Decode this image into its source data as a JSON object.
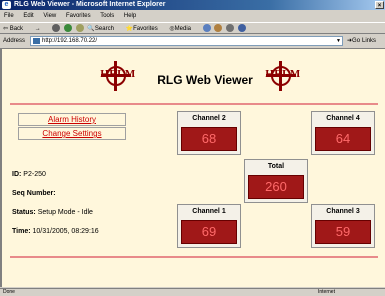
{
  "window": {
    "title": "RLG Web Viewer - Microsoft Internet Explorer"
  },
  "menu": [
    "File",
    "Edit",
    "View",
    "Favorites",
    "Tools",
    "Help"
  ],
  "toolbar": {
    "back": "Back",
    "forward": "→",
    "search": "Search",
    "favorites": "Favorites",
    "media": "Media"
  },
  "address": {
    "label": "Address",
    "url": "http://192.168.70.22/",
    "go": "Go",
    "links": "Links"
  },
  "page": {
    "logo_text": "HELM",
    "title": "RLG Web Viewer",
    "links": {
      "alarm_history": "Alarm History",
      "change_settings": "Change Settings"
    },
    "info": {
      "id_label": "ID:",
      "id_value": "P2-250",
      "seq_label": "Seq Number:",
      "seq_value": "",
      "status_label": "Status:",
      "status_value": "Setup Mode - Idle",
      "time_label": "Time:",
      "time_value": "10/31/2005, 08:29:16"
    },
    "channels": {
      "ch2": {
        "label": "Channel 2",
        "value": "68"
      },
      "ch4": {
        "label": "Channel 4",
        "value": "64"
      },
      "total": {
        "label": "Total",
        "value": "260"
      },
      "ch1": {
        "label": "Channel 1",
        "value": "69"
      },
      "ch3": {
        "label": "Channel 3",
        "value": "59"
      }
    }
  },
  "status": {
    "left": "Done",
    "zone": "Internet"
  },
  "colors": {
    "accent": "#c00000",
    "display_bg": "#a01818",
    "display_text": "#ff6a6a",
    "page_bg": "#fff7dc"
  }
}
